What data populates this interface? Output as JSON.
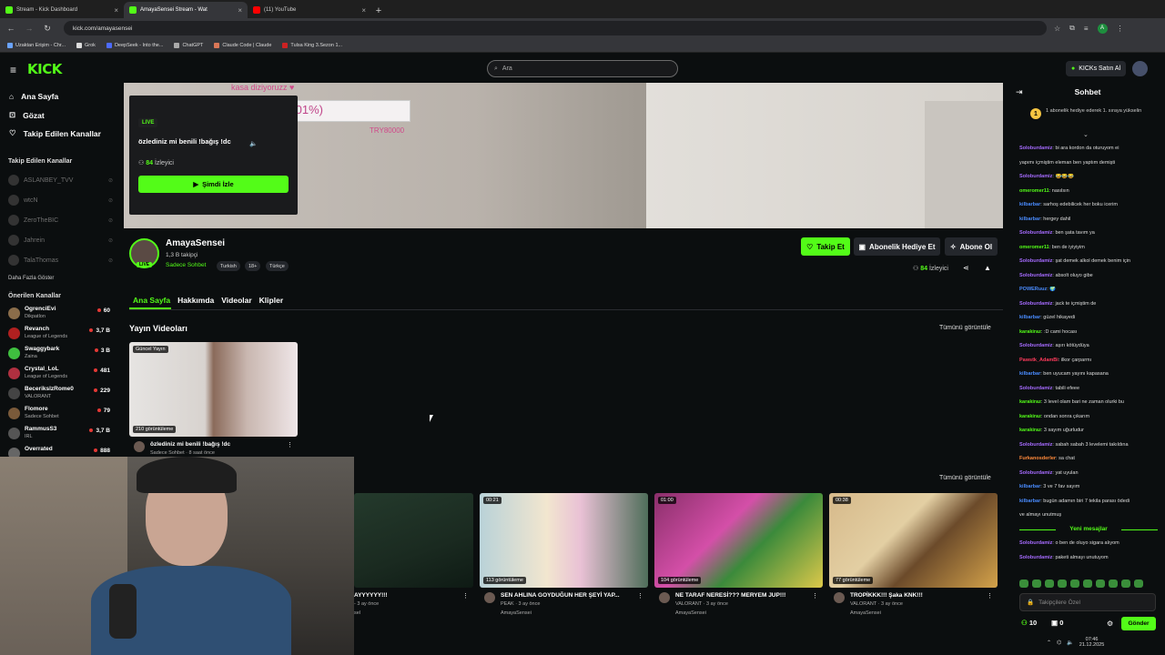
{
  "browser": {
    "tabs": [
      {
        "label": "Stream - Kick Dashboard",
        "color": "#53fc18"
      },
      {
        "label": "AmayaSensei Stream - Wat",
        "color": "#53fc18"
      },
      {
        "label": "(11) YouTube",
        "color": "#ff0000"
      }
    ],
    "url": "kick.com/amayasensei",
    "bookmarks": [
      "Uzaktan Erişim - Chr...",
      "Grok",
      "DeepSeek - Into the...",
      "ChatGPT",
      "Claude Code | Claude",
      "Tulsa King 3.Sezon 1..."
    ],
    "profile_initial": "A"
  },
  "header": {
    "logo": "KICK",
    "search_placeholder": "Ara",
    "buy_ai": "KICKs Satın Al"
  },
  "sidebar": {
    "nav": [
      {
        "icon": "⌂",
        "label": "Ana Sayfa"
      },
      {
        "icon": "⊡",
        "label": "Gözat"
      },
      {
        "icon": "♡",
        "label": "Takip Edilen Kanallar"
      }
    ],
    "followed_title": "Takip Edilen Kanallar",
    "followed": [
      "ASLANBEY_TVV",
      "wtcN",
      "ZeroTheBIC",
      "Jahrein",
      "TalaThomas"
    ],
    "show_more": "Daha Fazla Göster",
    "recommended_title": "Önerilen Kanallar",
    "recommended": [
      {
        "name": "OgrenciEvi",
        "game": "Dikpatlon",
        "viewers": "60",
        "color": "#8a6d4a"
      },
      {
        "name": "Revanch",
        "game": "League of Legends",
        "viewers": "3,7 B",
        "color": "#b02020"
      },
      {
        "name": "Swaggybark",
        "game": "Zaina",
        "viewers": "3 B",
        "color": "#3fbf3f"
      },
      {
        "name": "Crystal_LoL",
        "game": "League of Legends",
        "viewers": "481",
        "color": "#b03040"
      },
      {
        "name": "BecerikslzRome0",
        "game": "VALORANT",
        "viewers": "229",
        "color": "#444"
      },
      {
        "name": "Flomore",
        "game": "Sadece Sohbet",
        "viewers": "79",
        "color": "#7a5a3a"
      },
      {
        "name": "RammusS3",
        "game": "IRL",
        "viewers": "3,7 B",
        "color": "#555"
      },
      {
        "name": "Overrated",
        "game": "",
        "viewers": "888",
        "color": "#666"
      }
    ]
  },
  "hero": {
    "overlay_text_1": "kasa diziyoruzz ♥",
    "overlay_text_2": ".01%)",
    "overlay_text_3": "TRY80000",
    "live": "LIVE",
    "title": "özlediniz mi benili !bağış !dc",
    "viewers": "84",
    "viewers_label": "İzleyici",
    "watch_now": "Şimdi İzle"
  },
  "channel": {
    "name": "AmayaSensei",
    "followers": "1,3 B takipçi",
    "category": "Sadece Sohbet",
    "tags": [
      "Turkish",
      "18+",
      "Türkçe"
    ],
    "follow": "Takip Et",
    "gift_sub": "Abonelik Hediye Et",
    "subscribe": "Abone Ol",
    "viewers": "84",
    "viewers_label": "İzleyici",
    "live_badge": "LIVE"
  },
  "tabs": [
    "Ana Sayfa",
    "Hakkımda",
    "Videolar",
    "Klipler"
  ],
  "sections": {
    "streams_title": "Yayın Videoları",
    "see_all": "Tümünü görüntüle"
  },
  "latest_stream": {
    "badge": "Güncel Yayın",
    "views": "210 görüntüleme",
    "title": "özlediniz mi benili !bağış !dc",
    "meta": "Sadece Sohbet · 8 saat önce"
  },
  "clips": [
    {
      "duration": "",
      "views": "",
      "title": "AYYYYYY!!!",
      "meta": "- 3 ay önce",
      "channel": "sel"
    },
    {
      "duration": "00:21",
      "views": "113 görüntüleme",
      "title": "SEN AHLINA GOYDUĞUN HER ŞEYİ YAP...",
      "meta": "PEAK · 3 ay önce",
      "channel": "AmayaSensei"
    },
    {
      "duration": "01:00",
      "views": "104 görüntüleme",
      "title": "NE TARAF NERESİ??? MERYEM JUP!!!",
      "meta": "VALORANT · 3 ay önce",
      "channel": "AmayaSensei"
    },
    {
      "duration": "00:38",
      "views": "77 görüntüleme",
      "title": "TROPİKKK!!! Şaka KNK!!!",
      "meta": "VALORANT · 3 ay önce",
      "channel": "AmayaSensei"
    }
  ],
  "chat": {
    "title": "Sohbet",
    "pinned_number": "1",
    "pinned": "1 abonelik hediye ederek 1. sıraya yükselin",
    "messages": [
      {
        "user": "Soloburdamiz",
        "text": "bi ara kordon da oturuyom ei",
        "color": "#a66bff"
      },
      {
        "user": "",
        "text": "yapımı içmiştim eleman ben yaptım demişti",
        "color": "#a66bff"
      },
      {
        "user": "Soloburdamiz",
        "text": "😂😂😂",
        "color": "#a66bff"
      },
      {
        "user": "omeromer11",
        "text": "nasılsın",
        "color": "#53fc18"
      },
      {
        "user": "kilbarbar",
        "text": "sarhoş edebilicek her boku icerim",
        "color": "#4a8cff"
      },
      {
        "user": "kilbarbar",
        "text": "hergey dahil",
        "color": "#4a8cff"
      },
      {
        "user": "Soloburdamiz",
        "text": "ben şata tavım ya",
        "color": "#a66bff"
      },
      {
        "user": "omeromer11",
        "text": "ben de iyiyiyim",
        "color": "#53fc18"
      },
      {
        "user": "Soloburdamiz",
        "text": "şat demek alkol demek benim için",
        "color": "#a66bff"
      },
      {
        "user": "Soloburdamiz",
        "text": "absolt oluyo gibe",
        "color": "#a66bff"
      },
      {
        "user": "POWERuuz",
        "text": "🌍",
        "color": "#4a8cff"
      },
      {
        "user": "Soloburdamiz",
        "text": "jack te içmiştim de",
        "color": "#a66bff"
      },
      {
        "user": "kilbarbar",
        "text": "güzel hikayedi",
        "color": "#4a8cff"
      },
      {
        "user": "karakiraz",
        "text": ":D cami hocası",
        "color": "#53fc18"
      },
      {
        "user": "Soloburdamiz",
        "text": "aşırı kötüydüya",
        "color": "#a66bff"
      },
      {
        "user": "Pawstk_AdamBi",
        "text": "ilkor çarparmı",
        "color": "#ff3b5c"
      },
      {
        "user": "kilbarbar",
        "text": "ben uyucam yayını kapasana",
        "color": "#4a8cff"
      },
      {
        "user": "Soloburdamiz",
        "text": "tabili efeee",
        "color": "#a66bff"
      },
      {
        "user": "karakiraz",
        "text": "3 level olam bari ne zaman olurki bu",
        "color": "#53fc18"
      },
      {
        "user": "karakiraz",
        "text": "ondan sonra çıkarım",
        "color": "#53fc18"
      },
      {
        "user": "karakiraz",
        "text": "3 sayım uğurludur",
        "color": "#53fc18"
      },
      {
        "user": "Soloburdamiz",
        "text": "sabah sabah 3 levelemi takıldına",
        "color": "#a66bff"
      },
      {
        "user": "Furkanosderler",
        "text": "sa chat",
        "color": "#ff8a3b"
      },
      {
        "user": "Soloburdamiz",
        "text": "yat uyulan",
        "color": "#a66bff"
      },
      {
        "user": "kilbarbar",
        "text": "3 ve 7 fav sayım",
        "color": "#4a8cff"
      },
      {
        "user": "kilbarbar",
        "text": "bugün adamın biri 7 tekila parası ödedi",
        "color": "#4a8cff"
      },
      {
        "user": "",
        "text": "ve almayı unutmuş",
        "color": "#4a8cff"
      }
    ],
    "new_messages": "Yeni mesajlar",
    "after_messages": [
      {
        "user": "Soloburdamiz",
        "text": "o ben de oluyo sigara alıyom",
        "color": "#a66bff"
      },
      {
        "user": "Soloburdamiz",
        "text": "paketi almayı unutuyom",
        "color": "#a66bff"
      }
    ],
    "input_placeholder": "Takipçilere Özel",
    "points": "10",
    "gifts": "0",
    "send": "Gönder"
  },
  "system": {
    "time": "07:46",
    "date": "21.12.2025"
  },
  "colors": {
    "accent": "#53fc18",
    "background": "#0b0e0f"
  }
}
